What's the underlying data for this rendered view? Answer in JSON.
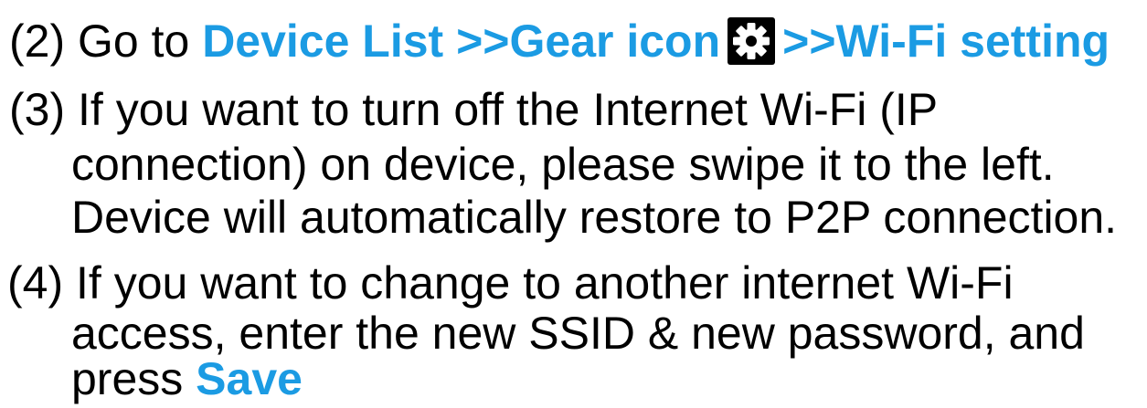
{
  "colors": {
    "text": "#000000",
    "accent": "#1b9be3",
    "background": "#ffffff"
  },
  "step2": {
    "text": "(2) Go to ",
    "path_start": "Device List >>Gear icon",
    "icon": "gear-icon",
    "path_end": ">>Wi-Fi setting"
  },
  "step3": {
    "number": "(3)",
    "lines": [
      "If you want to turn off the Internet Wi-Fi (IP",
      "connection) on device, please swipe it to the left.",
      "Device will automatically restore to P2P connection."
    ]
  },
  "step4": {
    "number": "(4)",
    "lines": [
      "If you want to change to another internet Wi-Fi",
      "access, enter the new SSID & new password, and"
    ],
    "last_line_prefix": "press",
    "save_label": "Save"
  }
}
